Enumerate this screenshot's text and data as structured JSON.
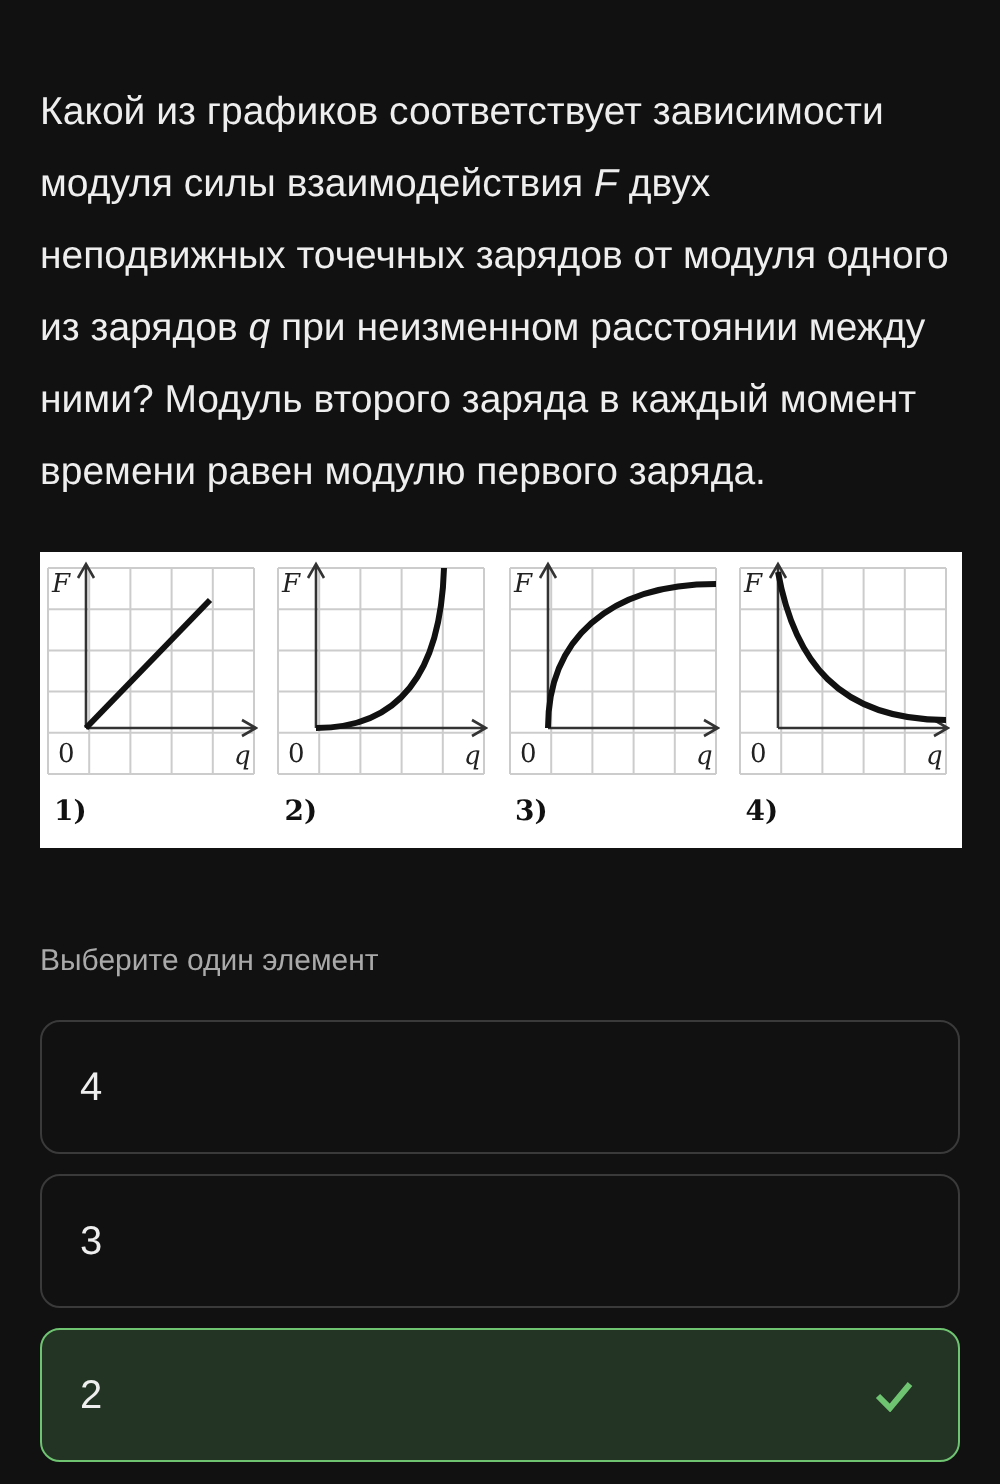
{
  "question": "Какой из графиков соответствует зависимости модуля силы взаимодействия *F* двух неподвижных точечных зарядов от модуля одного из зарядов *q* при неизменном расстоянии между ними? Модуль второго заряда в каждый момент времени равен модулю первого заряда.",
  "figure": {
    "panels": [
      {
        "kind": "linear",
        "y_label": "F",
        "x_label": "q",
        "origin": "0",
        "caption": "1)"
      },
      {
        "kind": "convex",
        "y_label": "F",
        "x_label": "q",
        "origin": "0",
        "caption": "2)"
      },
      {
        "kind": "concave",
        "y_label": "F",
        "x_label": "q",
        "origin": "0",
        "caption": "3)"
      },
      {
        "kind": "decreasing",
        "y_label": "F",
        "x_label": "q",
        "origin": "0",
        "caption": "4)"
      }
    ]
  },
  "prompt": "Выберите один элемент",
  "options": [
    {
      "label": "4",
      "selected": false
    },
    {
      "label": "3",
      "selected": false
    },
    {
      "label": "2",
      "selected": true
    }
  ]
}
